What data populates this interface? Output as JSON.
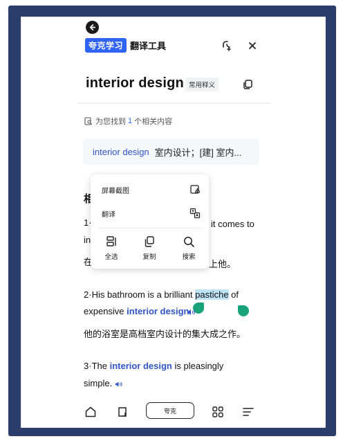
{
  "header": {
    "brand_badge": "夸克学习",
    "brand_name": "翻译工具",
    "icons": [
      "back-arrow-icon",
      "share-icon",
      "close-icon"
    ]
  },
  "word": {
    "title": "interior design",
    "tag": "常用释义"
  },
  "search": {
    "found_prefix": "为您找到",
    "found_count": "1",
    "found_suffix": "个相关内容"
  },
  "result": {
    "en": "interior design",
    "zh": "室内设计；[建] 室内..."
  },
  "section": {
    "heading_visible": "相"
  },
  "examples": [
    {
      "num": "1·",
      "visible_right": "it comes to",
      "line2_left": "in",
      "line3_left": "在",
      "line3_right": "上他。"
    },
    {
      "num": "2·",
      "text_before": "His bathroom is a brilliant ",
      "text_selected": "pastiche",
      "text_after": " of",
      "line2_before": "expensive ",
      "line2_link": "interior design",
      "line2_after": ".",
      "zh": "他的浴室是高档室内设计的集大成之作。"
    },
    {
      "num": "3·",
      "text_before": "The ",
      "text_link": "interior design",
      "text_after": " is pleasingly",
      "line2": "simple."
    }
  ],
  "context_menu": {
    "screenshot_label": "屏幕截图",
    "translate_label": "翻译",
    "select_all_label": "全选",
    "copy_label": "复制",
    "search_label": "搜索"
  },
  "bottom_nav": {
    "center_label": "夸克"
  },
  "colors": {
    "accent": "#2f63f6",
    "link": "#2f55c8",
    "selection": "#bfe3f7",
    "handle": "#1aa37a",
    "frame": "#2b3e6b"
  }
}
